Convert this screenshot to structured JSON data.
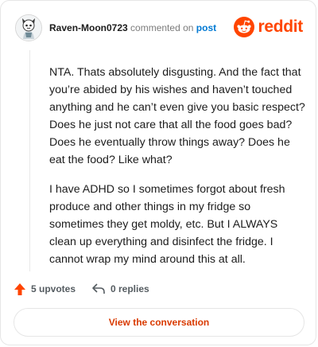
{
  "comment": {
    "username": "Raven-Moon0723",
    "action_text": "commented on",
    "post_link": "post",
    "avatar_icon": "snoo-avatar-icon",
    "paragraphs": [
      "NTA. Thats absolutely disgusting. And the fact that you’re abided by his wishes and haven’t touched anything and he can’t even give you basic respect? Does he just not care that all the food goes bad? Does he eventually throw things away? Does he eat the food? Like what?",
      "I have ADHD so I sometimes forgot about fresh produce and other things in my fridge so sometimes they get moldy, etc. But I ALWAYS clean up everything and disinfect the fridge. I cannot wrap my mind around this at all."
    ]
  },
  "brand": {
    "wordmark": "reddit",
    "icon": "reddit-logo-icon",
    "color": "#ff4500"
  },
  "footer": {
    "upvotes": "5 upvotes",
    "upvote_icon": "upvote-arrow-icon",
    "replies": "0 replies",
    "reply_icon": "reply-arrow-icon",
    "view_conversation": "View the conversation"
  },
  "colors": {
    "upvote": "#ff4500",
    "link": "#0079d3",
    "cta": "#d93a00"
  }
}
